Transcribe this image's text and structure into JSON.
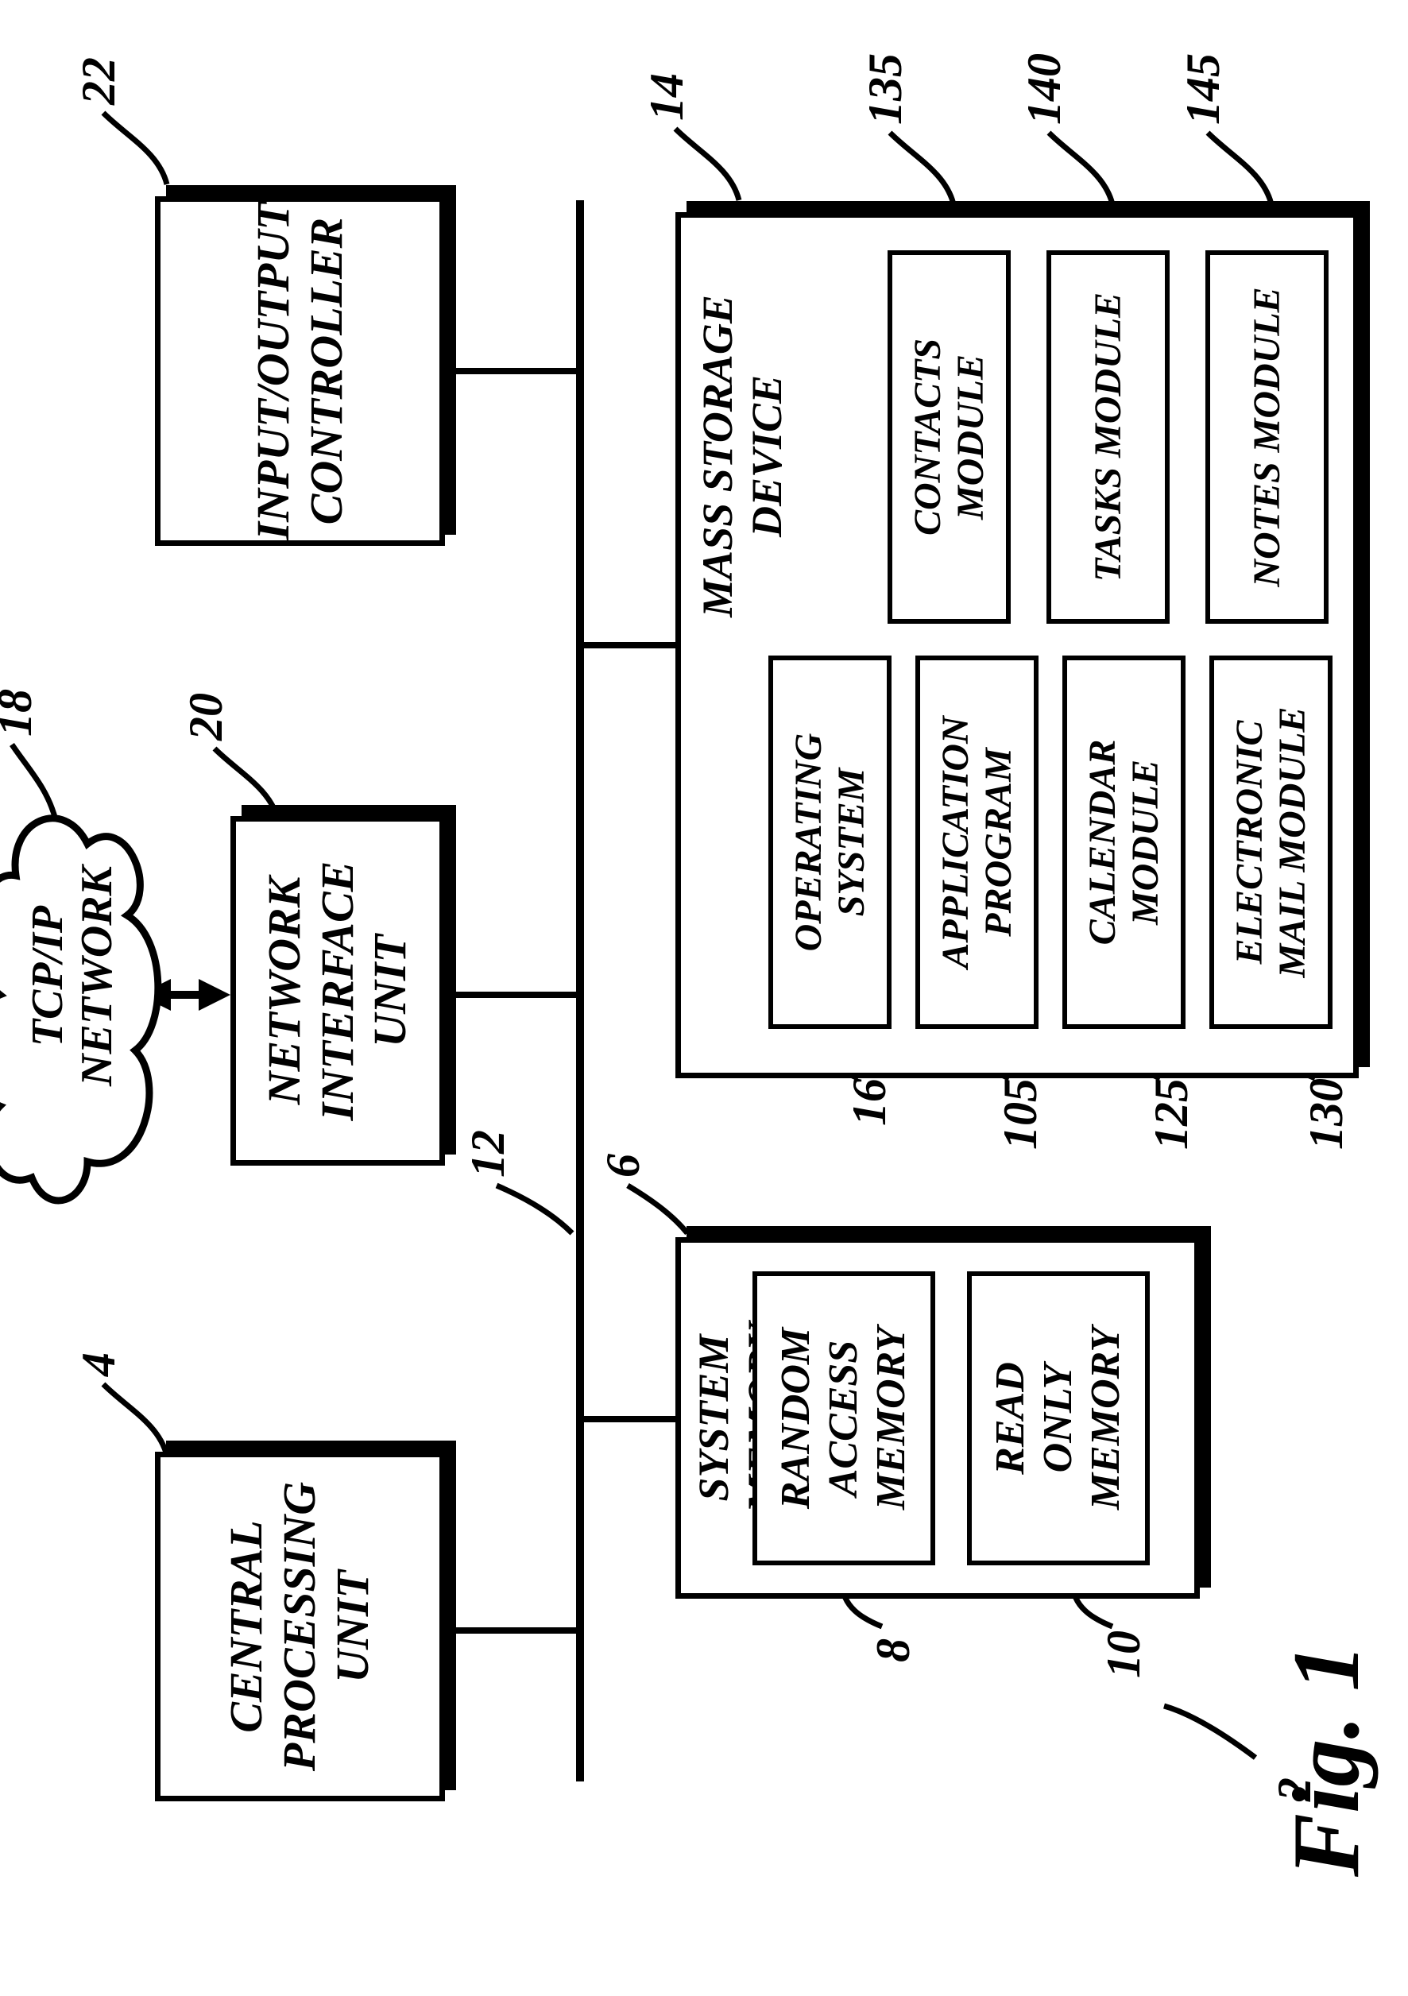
{
  "figure": "Fig. 1",
  "cloud": {
    "label": "TCP/IP\nNETWORK"
  },
  "blocks": {
    "cpu": {
      "label": "CENTRAL\nPROCESSING\nUNIT"
    },
    "nic": {
      "label": "NETWORK\nINTERFACE\nUNIT"
    },
    "ioc": {
      "label": "INPUT/OUTPUT\nCONTROLLER"
    },
    "sysmem": {
      "title": "SYSTEM\nMEMORY",
      "ram": "RANDOM\nACCESS\nMEMORY",
      "rom": "READ\nONLY\nMEMORY"
    },
    "msd": {
      "title": "MASS STORAGE\nDEVICE",
      "os": "OPERATING\nSYSTEM",
      "app": "APPLICATION\nPROGRAM",
      "cal": "CALENDAR\nMODULE",
      "mail": "ELECTRONIC\nMAIL MODULE",
      "contacts": "CONTACTS\nMODULE",
      "tasks": "TASKS MODULE",
      "notes": "NOTES MODULE"
    }
  },
  "refs": {
    "r2": "2",
    "r4": "4",
    "r6": "6",
    "r8": "8",
    "r10": "10",
    "r12": "12",
    "r14": "14",
    "r16": "16",
    "r18": "18",
    "r20": "20",
    "r22": "22",
    "r105": "105",
    "r125": "125",
    "r130": "130",
    "r135": "135",
    "r140": "140",
    "r145": "145"
  }
}
